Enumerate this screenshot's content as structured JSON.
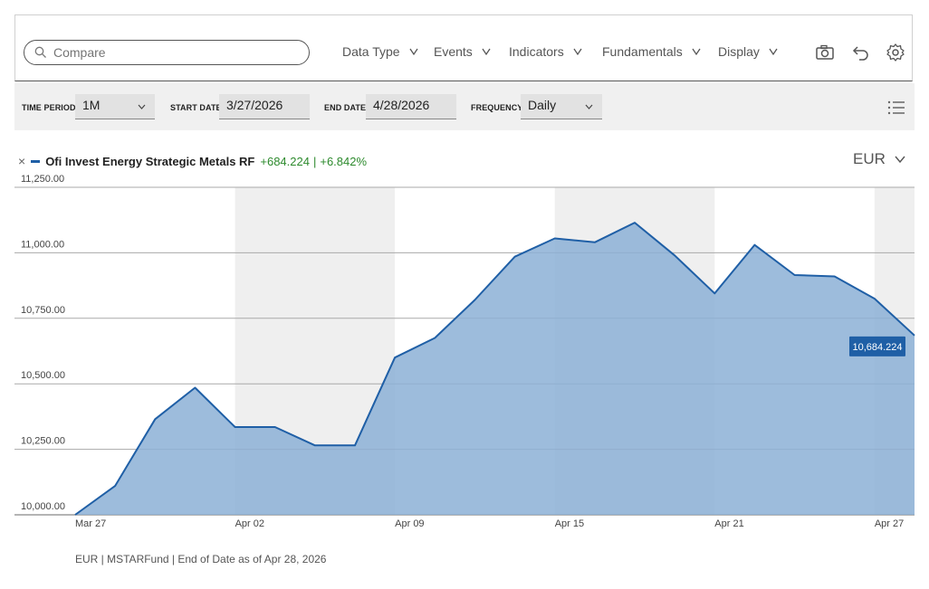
{
  "toolbar": {
    "search_placeholder": "Compare",
    "menus": [
      "Data Type",
      "Events",
      "Indicators",
      "Fundamentals",
      "Display"
    ]
  },
  "controls": {
    "time_period_label": "TIME PERIOD",
    "time_period_value": "1M",
    "start_date_label": "START DATE",
    "start_date_value": "3/27/2026",
    "end_date_label": "END DATE",
    "end_date_value": "4/28/2026",
    "frequency_label": "FREQUENCY",
    "frequency_value": "Daily"
  },
  "legend": {
    "close_symbol": "×",
    "series_name": "Ofi Invest Energy Strategic Metals RF",
    "change_abs": "+684.224",
    "separator": "|",
    "change_pct": "+6.842%"
  },
  "currency": "EUR",
  "footer": "EUR | MSTARFund | End of Date as of Apr 28, 2026",
  "colors": {
    "line": "#1f5fa6",
    "fill": "#8cb0d6",
    "positive": "#2d8a2d",
    "band": "#efefef"
  },
  "chart_data": {
    "type": "area",
    "ylim": [
      10000,
      11250
    ],
    "yticks": [
      10000,
      10250,
      10500,
      10750,
      11000,
      11250
    ],
    "ytick_labels": [
      "10,000.00",
      "10,250.00",
      "10,500.00",
      "10,750.00",
      "11,000.00",
      "11,250.00"
    ],
    "x": [
      "2026-03-27",
      "2026-03-30",
      "2026-03-31",
      "2026-04-01",
      "2026-04-02",
      "2026-04-03",
      "2026-04-06",
      "2026-04-07",
      "2026-04-08",
      "2026-04-09",
      "2026-04-10",
      "2026-04-13",
      "2026-04-14",
      "2026-04-15",
      "2026-04-16",
      "2026-04-17",
      "2026-04-20",
      "2026-04-21",
      "2026-04-22",
      "2026-04-23",
      "2026-04-24",
      "2026-04-27",
      "2026-04-28"
    ],
    "values": [
      10000,
      10110,
      10365,
      10485,
      10335,
      10335,
      10265,
      10265,
      10600,
      10675,
      10820,
      10985,
      11055,
      11040,
      11115,
      10990,
      10845,
      11030,
      10915,
      10910,
      10825,
      10684.224
    ],
    "xtick_labels": [
      "Mar 27",
      "Apr 02",
      "Apr 09",
      "Apr 15",
      "Apr 21",
      "Apr 27"
    ],
    "series": [
      {
        "name": "Ofi Invest Energy Strategic Metals RF"
      }
    ],
    "last_value_label": "10,684.224",
    "grid": true
  }
}
